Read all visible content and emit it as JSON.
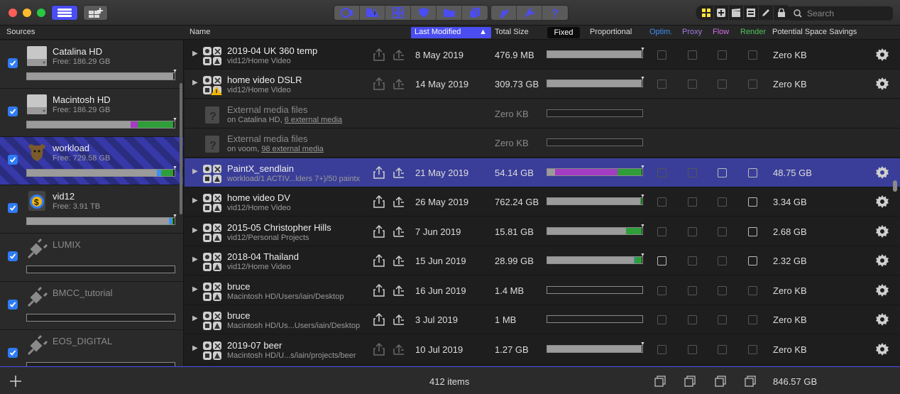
{
  "toolbar": {
    "search_placeholder": "Search",
    "left_buttons": [
      "library-icon",
      "add-library-icon"
    ],
    "group1_icons": [
      "camera-icon",
      "warning-icon",
      "grid-icon",
      "shield-icon",
      "folder-icon",
      "copy-icon"
    ],
    "group2_icons": [
      "archive-icon",
      "plug-icon",
      "help-icon"
    ],
    "group3_icons": [
      "yellow-grid-icon",
      "add-icon",
      "clapper-icon",
      "film-icon",
      "pencil-icon",
      "lock-icon"
    ]
  },
  "columns": {
    "sources": "Sources",
    "name": "Name",
    "last_modified": "Last Modified",
    "total_size": "Total Size",
    "fixed": "Fixed",
    "proportional": "Proportional",
    "optim": "Optim.",
    "proxy": "Proxy",
    "flow": "Flow",
    "render": "Render",
    "savings": "Potential Space Savings"
  },
  "colors": {
    "accent": "#4a4df0",
    "optim": "#3d8ef7",
    "proxy": "#a57be0",
    "flow": "#d26de8",
    "render": "#4fc45a",
    "bar_gray": "#9b9b9b",
    "bar_purple": "#a43cc4",
    "bar_green": "#2f9e3a"
  },
  "sources": [
    {
      "name": "Catalina HD",
      "free": "Free: 186.29 GB",
      "icon": "hard-drive-icon",
      "checked": true,
      "dim": false,
      "selected": false,
      "bar": [
        {
          "p": 0.99,
          "c": "#9b9b9b"
        }
      ]
    },
    {
      "name": "Macintosh HD",
      "free": "Free: 186.29 GB",
      "icon": "hard-drive-icon",
      "checked": true,
      "dim": false,
      "selected": false,
      "bar": [
        {
          "p": 0.7,
          "c": "#9b9b9b"
        },
        {
          "p": 0.05,
          "c": "#a43cc4"
        },
        {
          "p": 0.24,
          "c": "#2f9e3a"
        }
      ]
    },
    {
      "name": "workload",
      "free": "Free: 729.58 GB",
      "icon": "bull-icon",
      "checked": true,
      "dim": false,
      "selected": true,
      "bar": [
        {
          "p": 0.88,
          "c": "#9b9b9b"
        },
        {
          "p": 0.03,
          "c": "#3d8ef7"
        },
        {
          "p": 0.08,
          "c": "#2f9e3a"
        }
      ]
    },
    {
      "name": "vid12",
      "free": "Free: 3.91 TB",
      "icon": "dollar-disk-icon",
      "checked": true,
      "dim": false,
      "selected": false,
      "bar": [
        {
          "p": 0.96,
          "c": "#9b9b9b"
        },
        {
          "p": 0.02,
          "c": "#3d8ef7"
        },
        {
          "p": 0.01,
          "c": "#2f9e3a"
        }
      ]
    },
    {
      "name": "LUMIX",
      "free": "",
      "icon": "plug-icon",
      "checked": true,
      "dim": true,
      "selected": false,
      "bar": []
    },
    {
      "name": "BMCC_tutorial",
      "free": "",
      "icon": "plug-icon",
      "checked": true,
      "dim": true,
      "selected": false,
      "bar": []
    },
    {
      "name": "EOS_DIGITAL",
      "free": "",
      "icon": "plug-icon",
      "checked": true,
      "dim": true,
      "selected": false,
      "bar": []
    }
  ],
  "rows": [
    {
      "type": "library",
      "title": "2019-04 UK 360 temp",
      "sub": "vid12/Home Video",
      "sub_link": "",
      "date": "8 May 2019",
      "size": "476.9 MB",
      "bar": [
        {
          "p": 0.99,
          "c": "#9b9b9b"
        }
      ],
      "tick": true,
      "cb": [
        false,
        false,
        false,
        false
      ],
      "savings": "Zero KB",
      "warn": false,
      "grouped": false,
      "selected": false,
      "dim_actions": true
    },
    {
      "type": "library",
      "title": "home video DSLR",
      "sub": "vid12/Home Video",
      "sub_link": "",
      "date": "14 May 2019",
      "size": "309.73 GB",
      "bar": [
        {
          "p": 0.99,
          "c": "#9b9b9b"
        }
      ],
      "tick": true,
      "cb": [
        false,
        false,
        false,
        false
      ],
      "savings": "Zero KB",
      "warn": true,
      "grouped": true,
      "selected": false,
      "dim_actions": true
    },
    {
      "type": "external",
      "title": "External media files",
      "sub": "on Catalina HD, ",
      "sub_link": "6 external media",
      "date": "",
      "size": "Zero KB",
      "bar": [],
      "tick": false,
      "cb": [],
      "savings": "",
      "warn": false,
      "grouped": true,
      "selected": false,
      "dim_actions": true
    },
    {
      "type": "external",
      "title": "External media files",
      "sub": "on voom, ",
      "sub_link": "98 external media",
      "date": "",
      "size": "Zero KB",
      "bar": [],
      "tick": false,
      "cb": [],
      "savings": "",
      "warn": false,
      "grouped": true,
      "selected": false,
      "dim_actions": true
    },
    {
      "type": "library",
      "title": "PaintX_sendlain",
      "sub": "workload/1 ACTIV...lders 7+)/50 paintx",
      "sub_link": "",
      "date": "21 May 2019",
      "size": "54.14 GB",
      "bar": [
        {
          "p": 0.08,
          "c": "#9b9b9b"
        },
        {
          "p": 0.66,
          "c": "#a43cc4"
        },
        {
          "p": 0.25,
          "c": "#2f9e3a"
        }
      ],
      "tick": true,
      "cb": [
        false,
        false,
        true,
        true
      ],
      "savings": "48.75 GB",
      "warn": false,
      "grouped": false,
      "selected": true,
      "dim_actions": false
    },
    {
      "type": "library",
      "title": "home video DV",
      "sub": "vid12/Home Video",
      "sub_link": "",
      "date": "26 May 2019",
      "size": "762.24 GB",
      "bar": [
        {
          "p": 0.98,
          "c": "#9b9b9b"
        },
        {
          "p": 0.01,
          "c": "#2f9e3a"
        }
      ],
      "tick": true,
      "cb": [
        false,
        false,
        false,
        true
      ],
      "savings": "3.34 GB",
      "warn": false,
      "grouped": false,
      "selected": false,
      "dim_actions": false
    },
    {
      "type": "library",
      "title": "2015-05 Christopher Hills",
      "sub": "vid12/Personal Projects",
      "sub_link": "",
      "date": "7 Jun 2019",
      "size": "15.81 GB",
      "bar": [
        {
          "p": 0.83,
          "c": "#9b9b9b"
        },
        {
          "p": 0.16,
          "c": "#2f9e3a"
        }
      ],
      "tick": true,
      "cb": [
        false,
        false,
        false,
        true
      ],
      "savings": "2.68 GB",
      "warn": false,
      "grouped": false,
      "selected": false,
      "dim_actions": false
    },
    {
      "type": "library",
      "title": "2018-04 Thailand",
      "sub": "vid12/Home Video",
      "sub_link": "",
      "date": "15 Jun 2019",
      "size": "28.99 GB",
      "bar": [
        {
          "p": 0.91,
          "c": "#9b9b9b"
        },
        {
          "p": 0.01,
          "c": "#3d8ef7"
        },
        {
          "p": 0.07,
          "c": "#2f9e3a"
        }
      ],
      "tick": true,
      "cb": [
        true,
        false,
        false,
        true
      ],
      "savings": "2.32 GB",
      "warn": false,
      "grouped": false,
      "selected": false,
      "dim_actions": false
    },
    {
      "type": "library",
      "title": "bruce",
      "sub": "Macintosh HD/Users/iain/Desktop",
      "sub_link": "",
      "date": "16 Jun 2019",
      "size": "1.4 MB",
      "bar": [],
      "tick": false,
      "cb": [
        false,
        false,
        false,
        false
      ],
      "savings": "Zero KB",
      "warn": false,
      "grouped": false,
      "selected": false,
      "dim_actions": false
    },
    {
      "type": "library",
      "title": "bruce",
      "sub": "Macintosh HD/Us...Users/iain/Desktop",
      "sub_link": "",
      "date": "3 Jul 2019",
      "size": "1 MB",
      "bar": [],
      "tick": false,
      "cb": [
        false,
        false,
        false,
        false
      ],
      "savings": "Zero KB",
      "warn": false,
      "grouped": false,
      "selected": false,
      "dim_actions": false
    },
    {
      "type": "library",
      "title": "2019-07 beer",
      "sub": "Macintosh HD/U...s/iain/projects/beer",
      "sub_link": "",
      "date": "10 Jul 2019",
      "size": "1.27 GB",
      "bar": [
        {
          "p": 0.99,
          "c": "#9b9b9b"
        }
      ],
      "tick": true,
      "cb": [
        false,
        false,
        false,
        false
      ],
      "savings": "Zero KB",
      "warn": false,
      "grouped": false,
      "selected": false,
      "dim_actions": true
    }
  ],
  "footer": {
    "count": "412 items",
    "total": "846.57 GB",
    "add_icon": "add-icon",
    "icons": [
      "stack-icon",
      "stack-icon",
      "stack-icon",
      "stack-icon"
    ]
  }
}
